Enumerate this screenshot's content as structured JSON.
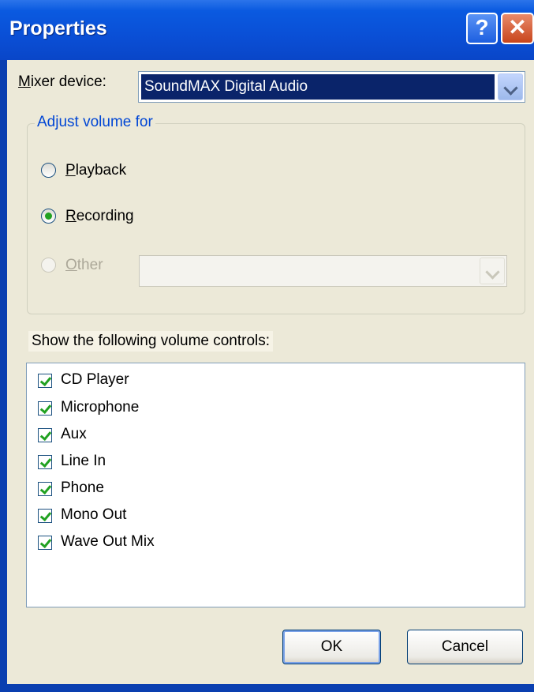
{
  "window": {
    "title": "Properties",
    "help_glyph": "?",
    "close_glyph": "✕"
  },
  "mixer": {
    "label_mnemonic": "M",
    "label_rest": "ixer device:",
    "selected": "SoundMAX Digital Audio"
  },
  "adjust": {
    "legend": "Adjust volume for",
    "options": [
      {
        "mnemonic": "P",
        "rest": "layback",
        "checked": false,
        "enabled": true
      },
      {
        "mnemonic": "R",
        "rest": "ecording",
        "checked": true,
        "enabled": true
      },
      {
        "mnemonic": "O",
        "rest": "ther",
        "checked": false,
        "enabled": false
      }
    ],
    "other_value": ""
  },
  "controls": {
    "label": "Show the following volume controls:",
    "items": [
      {
        "label": "CD Player",
        "checked": true
      },
      {
        "label": "Microphone",
        "checked": true
      },
      {
        "label": "Aux",
        "checked": true
      },
      {
        "label": "Line In",
        "checked": true
      },
      {
        "label": "Phone",
        "checked": true
      },
      {
        "label": "Mono Out",
        "checked": true
      },
      {
        "label": "Wave Out Mix",
        "checked": true
      }
    ]
  },
  "buttons": {
    "ok": "OK",
    "cancel": "Cancel"
  },
  "colors": {
    "titlebar": "#0a4fd6",
    "dialog_bg": "#ece9d8",
    "selection": "#0a246a",
    "check_green": "#21a121",
    "group_legend": "#0046d5"
  }
}
